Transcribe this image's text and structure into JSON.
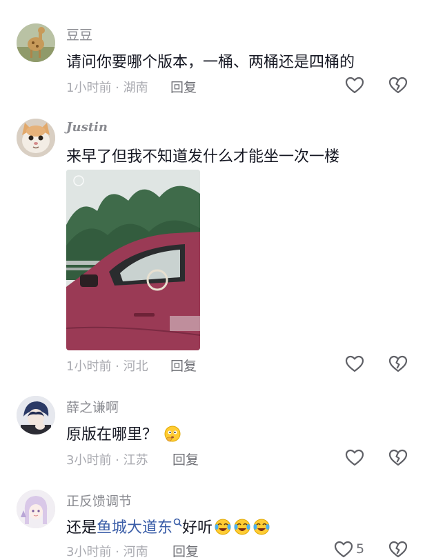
{
  "comments": [
    {
      "username": "豆豆",
      "text": "请问你要哪个版本，一桶、两桶还是四桶的",
      "meta": "1小时前 · 湖南",
      "reply_label": "回复"
    },
    {
      "username": "Justin",
      "text": "来早了但我不知道发什么才能坐一次一楼",
      "meta": "1小时前 · 河北",
      "reply_label": "回复"
    },
    {
      "username": "薛之谦啊",
      "text": "原版在哪里？",
      "meta": "3小时前 · 江苏",
      "reply_label": "回复"
    },
    {
      "username": "正反馈调节",
      "text_prefix": "还是",
      "link_text": "鱼城大道东",
      "text_suffix": "好听",
      "meta": "3小时前 · 河南",
      "reply_label": "回复",
      "like_count": "5"
    }
  ],
  "icons": {
    "like": "heart-outline-icon",
    "dislike": "broken-heart-icon",
    "emoji_think": "thinking-face-emoji",
    "emoji_laugh": "tears-of-joy-emoji",
    "search": "search-icon"
  },
  "colors": {
    "text": "#161823",
    "meta": "#a9aab0",
    "link": "#3b5ea8"
  }
}
